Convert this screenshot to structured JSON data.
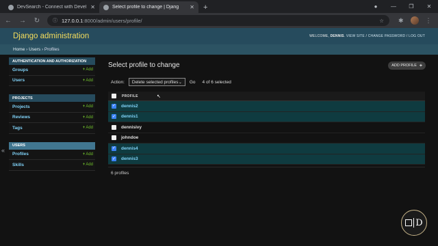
{
  "browser": {
    "tabs": [
      {
        "title": "DevSearch - Connect with Devel",
        "active": false
      },
      {
        "title": "Select profile to change | Djang",
        "active": true
      }
    ],
    "url_host": "127.0.0.1",
    "url_path": ":8000/admin/users/profile/"
  },
  "header": {
    "brand": "Django administration",
    "welcome": "WELCOME,",
    "username": "DENNIS",
    "view_site": "VIEW SITE",
    "change_password": "CHANGE PASSWORD",
    "log_out": "LOG OUT",
    "sep": "/"
  },
  "breadcrumbs": {
    "home": "Home",
    "users": "Users",
    "profiles": "Profiles",
    "sep": "›"
  },
  "sidebar": {
    "modules": [
      {
        "caption": "AUTHENTICATION AND AUTHORIZATION",
        "rows": [
          {
            "label": "Groups",
            "add": "Add"
          },
          {
            "label": "Users",
            "add": "Add"
          }
        ]
      },
      {
        "caption": "PROJECTS",
        "rows": [
          {
            "label": "Projects",
            "add": "Add"
          },
          {
            "label": "Reviews",
            "add": "Add"
          },
          {
            "label": "Tags",
            "add": "Add"
          }
        ]
      },
      {
        "caption": "USERS",
        "rows": [
          {
            "label": "Profiles",
            "add": "Add"
          },
          {
            "label": "Skills",
            "add": "Add"
          }
        ]
      }
    ],
    "collapse": "«"
  },
  "content": {
    "title": "Select profile to change",
    "add_button": "ADD PROFILE",
    "action_label": "Action:",
    "action_selected": "Delete selected profiles",
    "go": "Go",
    "counter": "4 of 6 selected",
    "column_header": "PROFILE",
    "rows": [
      {
        "name": "dennis2",
        "selected": true
      },
      {
        "name": "dennis1",
        "selected": true
      },
      {
        "name": "dennisivy",
        "selected": false
      },
      {
        "name": "johndoe",
        "selected": false
      },
      {
        "name": "dennis4",
        "selected": true
      },
      {
        "name": "dennis3",
        "selected": true
      }
    ],
    "paginator": "6 profiles"
  },
  "logo": {
    "letter": "D"
  }
}
